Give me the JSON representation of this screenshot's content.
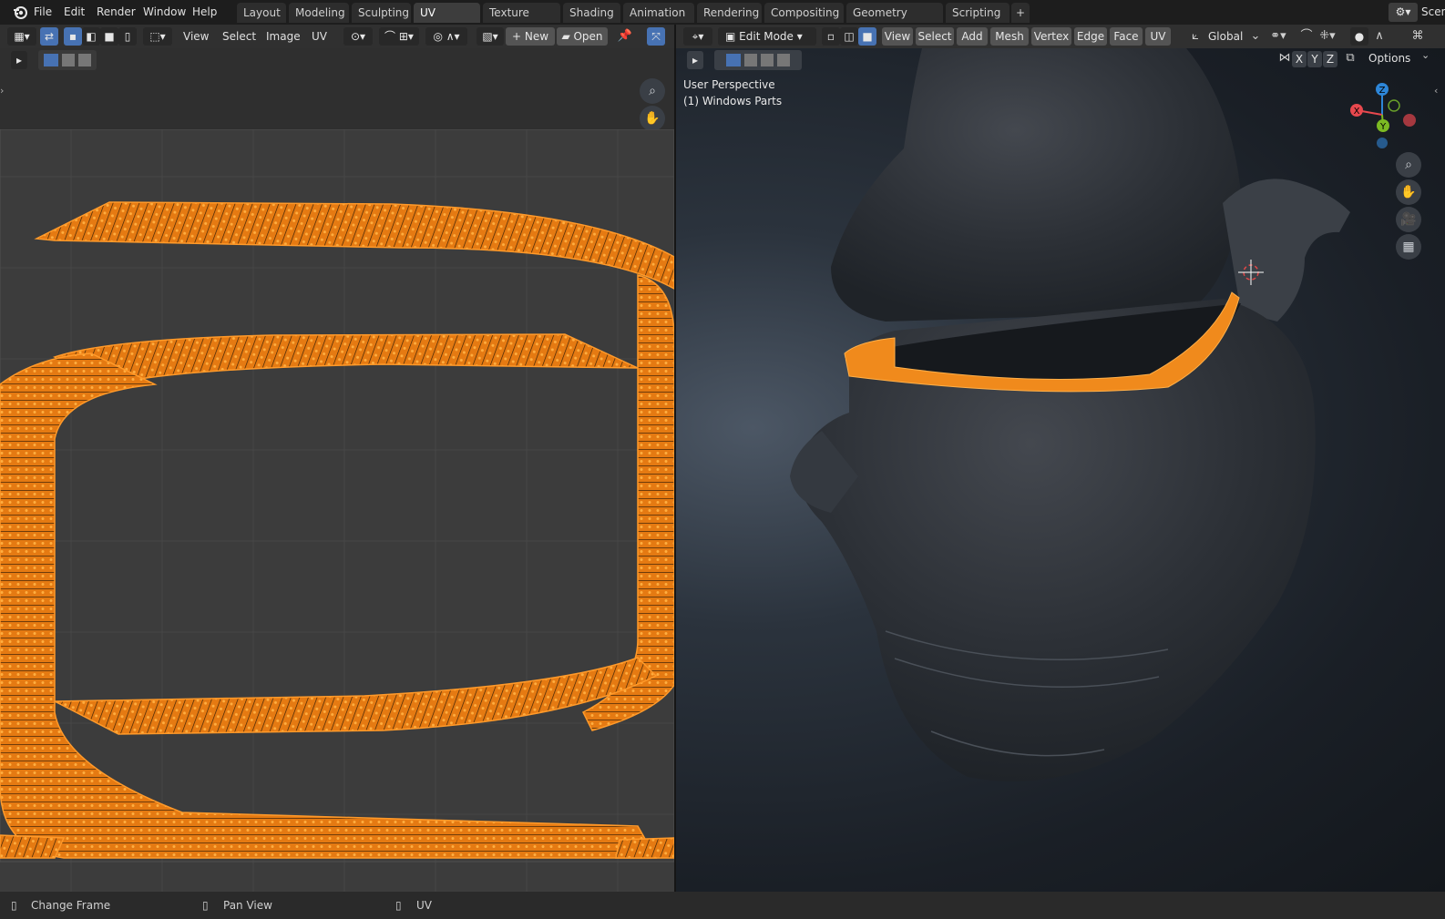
{
  "topbar": {
    "menus": [
      "File",
      "Edit",
      "Render",
      "Window",
      "Help"
    ],
    "workspaces": [
      "Layout",
      "Modeling",
      "Sculpting",
      "UV Editing",
      "Texture Paint",
      "Shading",
      "Animation",
      "Rendering",
      "Compositing",
      "Geometry Nodes",
      "Scripting"
    ],
    "active_workspace": "UV Editing",
    "add_tab": "+",
    "scene_label": "Scen"
  },
  "uv_header": {
    "menus": [
      "View",
      "Select",
      "Image",
      "UV"
    ],
    "new_label": "New",
    "open_label": "Open"
  },
  "viewport_header": {
    "mode": "Edit Mode",
    "menus": [
      "View",
      "Select",
      "Add",
      "Mesh",
      "Vertex",
      "Edge",
      "Face",
      "UV"
    ],
    "transform_orientation": "Global",
    "axes": [
      "X",
      "Y",
      "Z"
    ],
    "options_label": "Options"
  },
  "viewport": {
    "view_name": "User Perspective",
    "object_label": "(1) Windows Parts",
    "gizmo_axes": [
      "Z",
      "X",
      "Y"
    ]
  },
  "status": {
    "items": [
      "Change Frame",
      "Pan View",
      "UV"
    ]
  },
  "colors": {
    "uv_wire": "#ff8c1a",
    "accent": "#4772b3",
    "gizmo_x": "#e8484e",
    "gizmo_y": "#7cba23",
    "gizmo_z": "#2d86d8"
  }
}
